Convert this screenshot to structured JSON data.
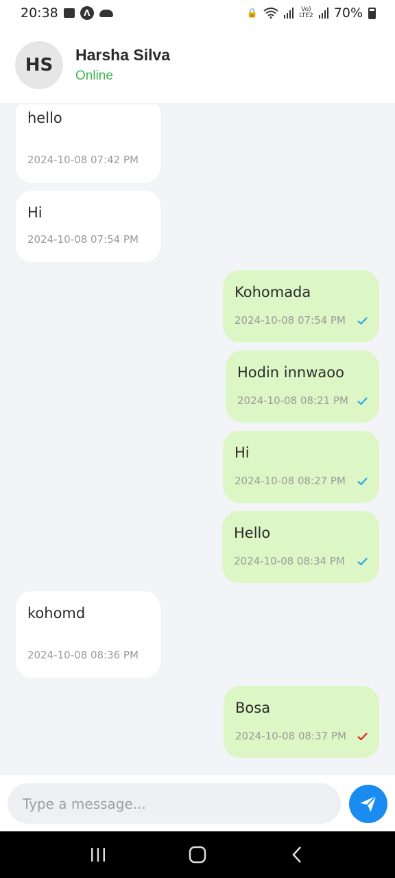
{
  "status_bar": {
    "time": "20:38",
    "battery": "70%"
  },
  "header": {
    "avatar_initials": "HS",
    "name": "Harsha Silva",
    "status": "Online",
    "status_color": "#3bb54a"
  },
  "messages": [
    {
      "direction": "in",
      "text": "hello",
      "time": "2024-10-08 07:42 PM"
    },
    {
      "direction": "in",
      "text": "Hi",
      "time": "2024-10-08 07:54 PM"
    },
    {
      "direction": "out",
      "text": "Kohomada",
      "time": "2024-10-08 07:54 PM",
      "tick": "read-check-icon"
    },
    {
      "direction": "out",
      "text": "Hodin innwaoo",
      "time": "2024-10-08 08:21 PM",
      "tick": "read-check-icon"
    },
    {
      "direction": "out",
      "text": "Hi",
      "time": "2024-10-08 08:27 PM",
      "tick": "read-check-icon"
    },
    {
      "direction": "out",
      "text": "Hello",
      "time": "2024-10-08 08:34 PM",
      "tick": "read-check-icon"
    },
    {
      "direction": "in",
      "text": "kohomd",
      "time": "2024-10-08 08:36 PM"
    },
    {
      "direction": "out",
      "text": "Bosa",
      "time": "2024-10-08 08:37 PM",
      "tick": "unread-check-icon"
    }
  ],
  "colors": {
    "read_tick": "#2aa7e0",
    "unread_tick": "#e02020",
    "outgoing_bubble": "#dcf7c5",
    "send_button": "#1a8cf0"
  },
  "composer": {
    "placeholder": "Type a message...",
    "value": ""
  }
}
